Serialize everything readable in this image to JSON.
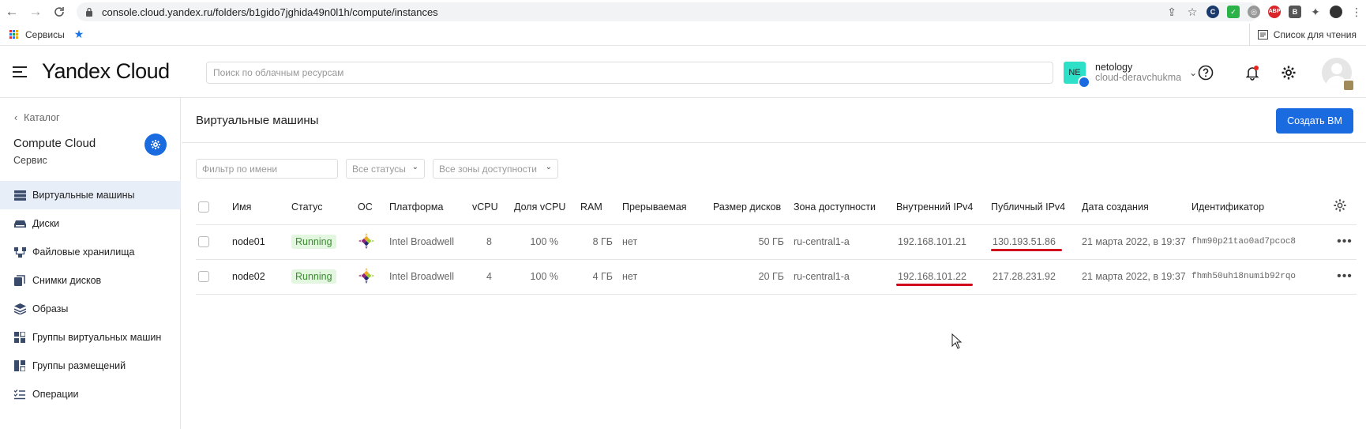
{
  "browser": {
    "url": "console.cloud.yandex.ru/folders/b1gido7jghida49n0l1h/compute/instances",
    "bookmark_apps": "Сервисы",
    "reading_list": "Список для чтения",
    "ext_abp": "ABP"
  },
  "header": {
    "logo": "Yandex Cloud",
    "search_placeholder": "Поиск по облачным ресурсам",
    "account_badge": "NE",
    "account_name": "netology",
    "account_cloud": "cloud-deravchukma"
  },
  "sidebar": {
    "back_label": "Каталог",
    "service_name": "Compute Cloud",
    "service_sub": "Сервис",
    "items": [
      {
        "label": "Виртуальные машины",
        "icon": "vm-icon"
      },
      {
        "label": "Диски",
        "icon": "disk-icon"
      },
      {
        "label": "Файловые хранилища",
        "icon": "file-storage-icon"
      },
      {
        "label": "Снимки дисков",
        "icon": "snapshot-icon"
      },
      {
        "label": "Образы",
        "icon": "images-icon"
      },
      {
        "label": "Группы виртуальных машин",
        "icon": "instance-groups-icon"
      },
      {
        "label": "Группы размещений",
        "icon": "placement-groups-icon"
      },
      {
        "label": "Операции",
        "icon": "operations-icon"
      }
    ]
  },
  "main": {
    "title": "Виртуальные машины",
    "create_button": "Создать ВМ",
    "filter_placeholder": "Фильтр по имени",
    "status_filter": "Все статусы",
    "zone_filter": "Все зоны доступности",
    "columns": [
      "Имя",
      "Статус",
      "ОС",
      "Платформа",
      "vCPU",
      "Доля vCPU",
      "RAM",
      "Прерываемая",
      "Размер дисков",
      "Зона доступности",
      "Внутренний IPv4",
      "Публичный IPv4",
      "Дата создания",
      "Идентификатор"
    ],
    "rows": [
      {
        "name": "node01",
        "status": "Running",
        "platform": "Intel Broadwell",
        "vcpu": "8",
        "vcpu_share": "100 %",
        "ram": "8 ГБ",
        "preemptible": "нет",
        "disk_size": "50 ГБ",
        "zone": "ru-central1-a",
        "internal_ip": "192.168.101.21",
        "public_ip": "130.193.51.86",
        "created": "21 марта 2022, в 19:37",
        "id": "fhm90p21tao0ad7pcoc8"
      },
      {
        "name": "node02",
        "status": "Running",
        "platform": "Intel Broadwell",
        "vcpu": "4",
        "vcpu_share": "100 %",
        "ram": "4 ГБ",
        "preemptible": "нет",
        "disk_size": "20 ГБ",
        "zone": "ru-central1-a",
        "internal_ip": "192.168.101.22",
        "public_ip": "217.28.231.92",
        "created": "21 марта 2022, в 19:37",
        "id": "fhmh50uh18numib92rqo"
      }
    ]
  },
  "colors": {
    "accent": "#1a6be0",
    "running_bg": "#e3f6e0",
    "running_text": "#3d8a33",
    "annotation_red": "#d0021b"
  }
}
